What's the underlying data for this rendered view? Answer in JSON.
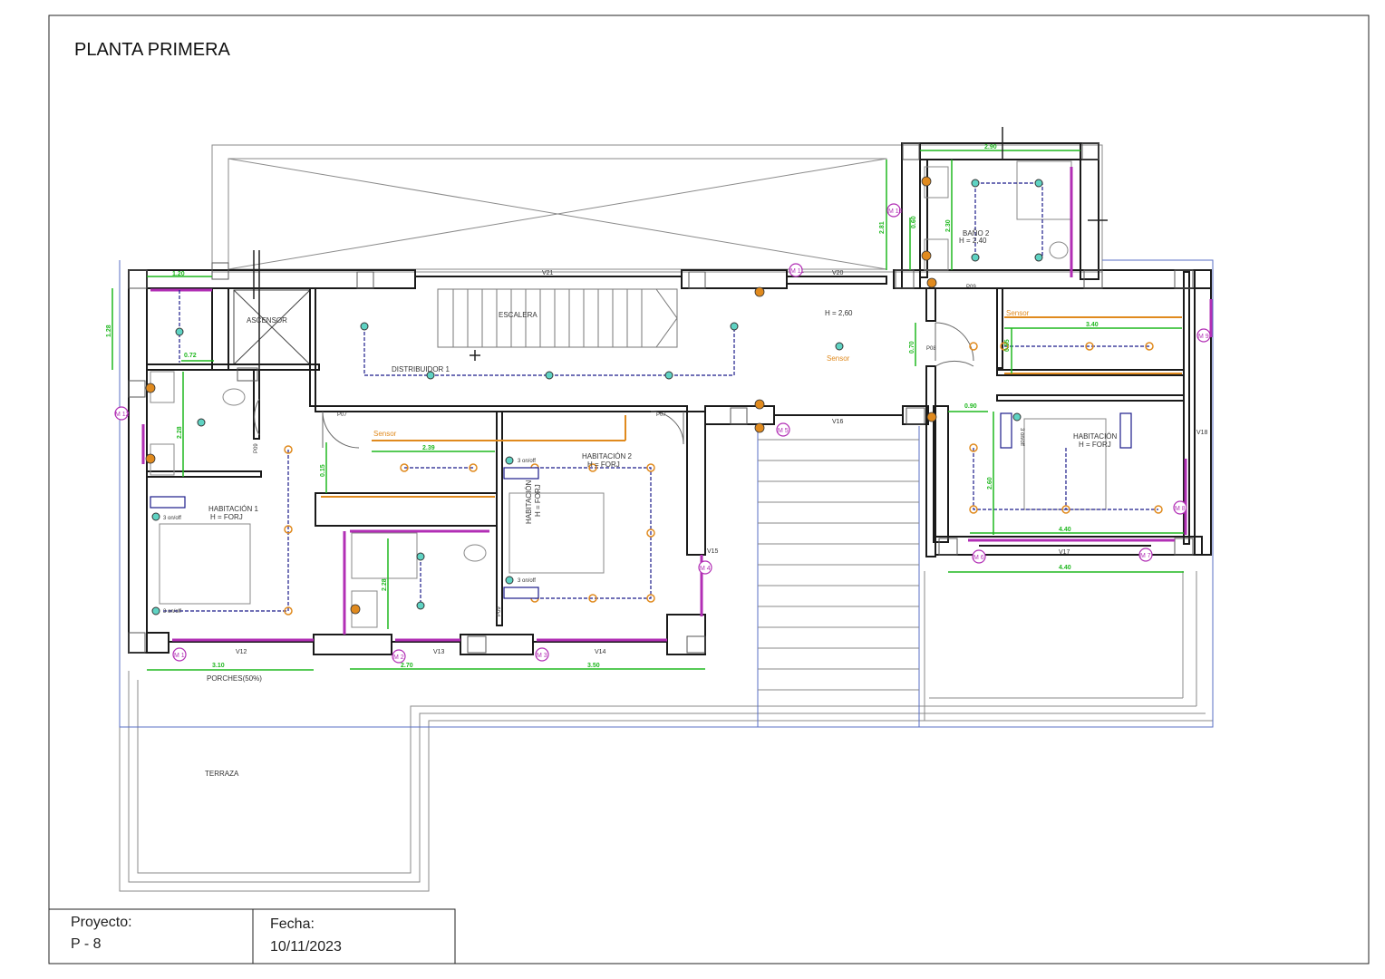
{
  "sheet": {
    "title": "PLANTA PRIMERA"
  },
  "title_block": {
    "project_label": "Proyecto:",
    "project_value": "P - 8",
    "date_label": "Fecha:",
    "date_value": "10/11/2023"
  },
  "rooms": {
    "ascensor": "ASCENSOR",
    "escalera": "ESCALERA",
    "distribuidor": "DISTRIBUIDOR 1",
    "distribuidor_height": "H = 2,60",
    "bano2": "BAÑO 2",
    "bano2_height": "H = 2,40",
    "hab1": "HABITACIÓN 1",
    "hab1_height": "H = FORJ",
    "hab2": "HABITACIÓN 2",
    "hab2_height": "H = FORJ",
    "hab3": "HABITACIÓN",
    "hab3_height": "H = FORJ",
    "hab_vertical": "HABITACIÓN",
    "hab_vertical_height": "H = FORJ",
    "porches": "PORCHES(50%)",
    "terraza": "TERRAZA"
  },
  "sensors": [
    "Sensor",
    "Sensor",
    "Sensor"
  ],
  "switch_labels": [
    "3 on/off",
    "3 on/off",
    "3 on/off",
    "3 on/off",
    "3 on/off"
  ],
  "windows": [
    "V21",
    "V20",
    "V16",
    "V12",
    "V13",
    "V14",
    "V15",
    "V17",
    "V18"
  ],
  "doors": [
    "P07",
    "P07",
    "P08",
    "P09",
    "P09",
    "P09"
  ],
  "dimensions": [
    "1.20",
    "1.28",
    "0.72",
    "2.28",
    "2.39",
    "0.15",
    "2.28",
    "3.10",
    "2.70",
    "3.50",
    "2.90",
    "2.81",
    "2.30",
    "0.70",
    "3.40",
    "0.55",
    "0.90",
    "2.60",
    "4.40",
    "4.40",
    "0.60"
  ],
  "motors": [
    "M 1",
    "M 2",
    "M 3",
    "M 4",
    "M 5",
    "M 6",
    "M 7",
    "M 8",
    "M 9",
    "M 10",
    "M 11",
    "M 12"
  ],
  "colors": {
    "wall": "#1a1a1a",
    "dimension": "#1fb81f",
    "circuit": "#1b1b8a",
    "pink": "#b22fb5",
    "orange": "#e08a1e",
    "light_fill": "#5fd3c3",
    "outline_blue": "#5a6fc4"
  }
}
